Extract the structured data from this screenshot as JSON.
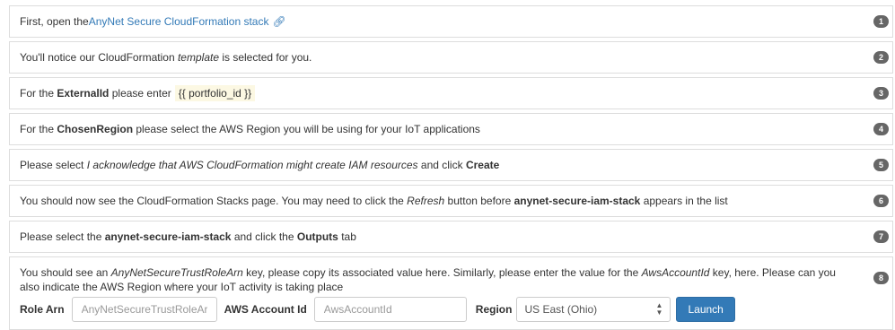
{
  "steps": [
    {
      "num": "1",
      "pre": "First, open the ",
      "link": "AnyNet Secure CloudFormation stack"
    },
    {
      "num": "2",
      "pre": "You'll notice our CloudFormation ",
      "em": "template",
      "post": " is selected for you."
    },
    {
      "num": "3",
      "pre": "For the ",
      "bold": "ExternalId",
      "post": " please enter ",
      "highlight": "{{ portfolio_id }}"
    },
    {
      "num": "4",
      "pre": "For the ",
      "bold": "ChosenRegion",
      "post": " please select the AWS Region you will be using for your IoT applications"
    },
    {
      "num": "5",
      "pre": "Please select ",
      "em": "I acknowledge that AWS CloudFormation might create IAM resources",
      "mid": " and click ",
      "bold": "Create"
    },
    {
      "num": "6",
      "pre": "You should now see the CloudFormation Stacks page. You may need to click the ",
      "em": "Refresh",
      "mid": " button before ",
      "bold": "anynet-secure-iam-stack",
      "post": " appears in the list"
    },
    {
      "num": "7",
      "pre": "Please select the ",
      "bold": "anynet-secure-iam-stack",
      "mid": " and click the ",
      "bold2": "Outputs",
      "post": " tab"
    },
    {
      "num": "8",
      "pre": "You should see an ",
      "em": "AnyNetSecureTrustRoleArn",
      "mid": " key, please copy its associated value here. Similarly, please enter the value for the ",
      "em2": "AwsAccountId",
      "post": " key, here. Please can you also indicate the AWS Region where your IoT activity is taking place"
    }
  ],
  "form": {
    "role_arn_label": "Role Arn",
    "role_arn_placeholder": "AnyNetSecureTrustRoleArn",
    "account_label": "AWS Account Id",
    "account_placeholder": "AwsAccountId",
    "region_label": "Region",
    "region_value": "US East (Ohio)",
    "launch_label": "Launch"
  },
  "icons": {
    "link": "external-link-icon",
    "select_caret": "up-down-caret-icon"
  },
  "colors": {
    "link": "#337ab7",
    "badge": "#666666",
    "highlight": "#fcf8e3",
    "button": "#337ab7"
  }
}
